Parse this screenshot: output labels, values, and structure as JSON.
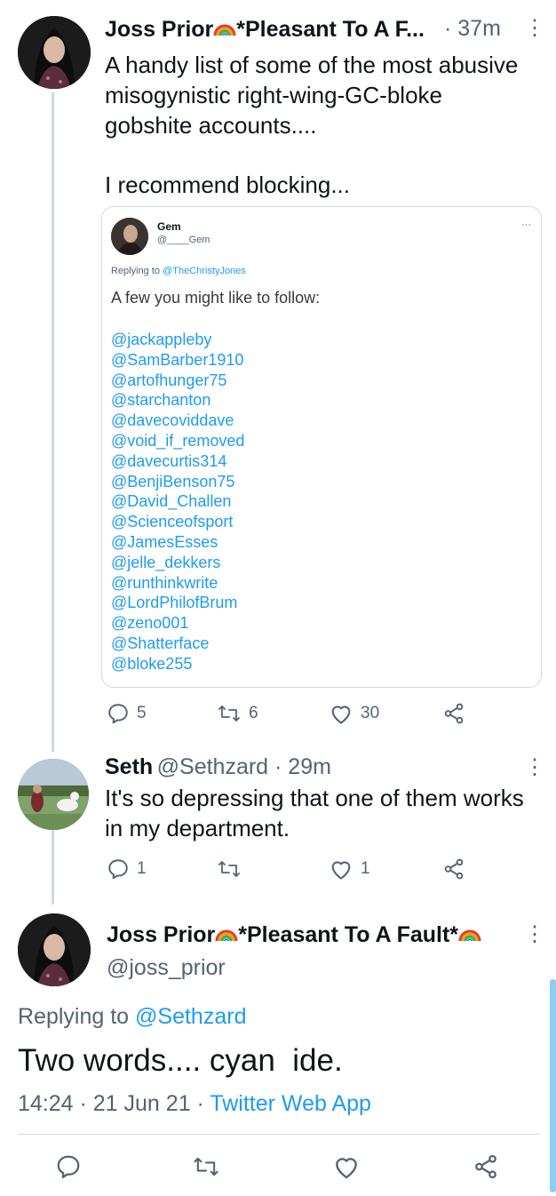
{
  "tweet1": {
    "author_name": "Joss Prior",
    "author_name_suffix": "*Pleasant To A F...",
    "time": "· 37m",
    "text_lines": [
      "A handy list of some of the most abusive",
      "misogynistic right-wing-GC-bloke",
      "gobshite accounts...."
    ],
    "text_line_2": "I recommend blocking...",
    "quote": {
      "name": "Gem",
      "handle": "@____Gem",
      "replying_prefix": "Replying to ",
      "replying_to": "@TheChristyJones",
      "text": "A few you might like to follow:",
      "handles": [
        "@jackappleby",
        "@SamBarber1910",
        "@artofhunger75",
        "@starchanton",
        "@davecoviddave",
        "@void_if_removed",
        "@davecurtis314",
        "@BenjiBenson75",
        "@David_Challen",
        "@Scienceofsport",
        "@JamesEsses",
        "@jelle_dekkers",
        "@runthinkwrite",
        "@LordPhilofBrum",
        "@zeno001",
        "@Shatterface",
        "@bloke255"
      ],
      "more": "···"
    },
    "actions": {
      "replies": "5",
      "retweets": "6",
      "likes": "30"
    }
  },
  "tweet2": {
    "author_name": "Seth",
    "handle_time": "@Sethzard · 29m",
    "text_lines": [
      "It's so depressing that one of them works",
      "in my department."
    ],
    "actions": {
      "replies": "1",
      "likes": "1"
    }
  },
  "tweet3": {
    "author_name": "Joss Prior",
    "author_name_suffix": "*Pleasant To A Fault*",
    "handle": "@joss_prior",
    "replying_prefix": "Replying to ",
    "replying_to": "@Sethzard",
    "text": "Two words.... cyan  ide.",
    "timestamp": "14:24 · 21 Jun 21 · ",
    "source": "Twitter Web App"
  },
  "icons": {
    "more": "⋮",
    "reply": "reply-icon",
    "retweet": "retweet-icon",
    "like": "heart-icon",
    "share": "share-icon"
  },
  "colors": {
    "link": "#1d9bf0",
    "secondary_text": "#536471",
    "thread_line": "#cfd9de"
  }
}
